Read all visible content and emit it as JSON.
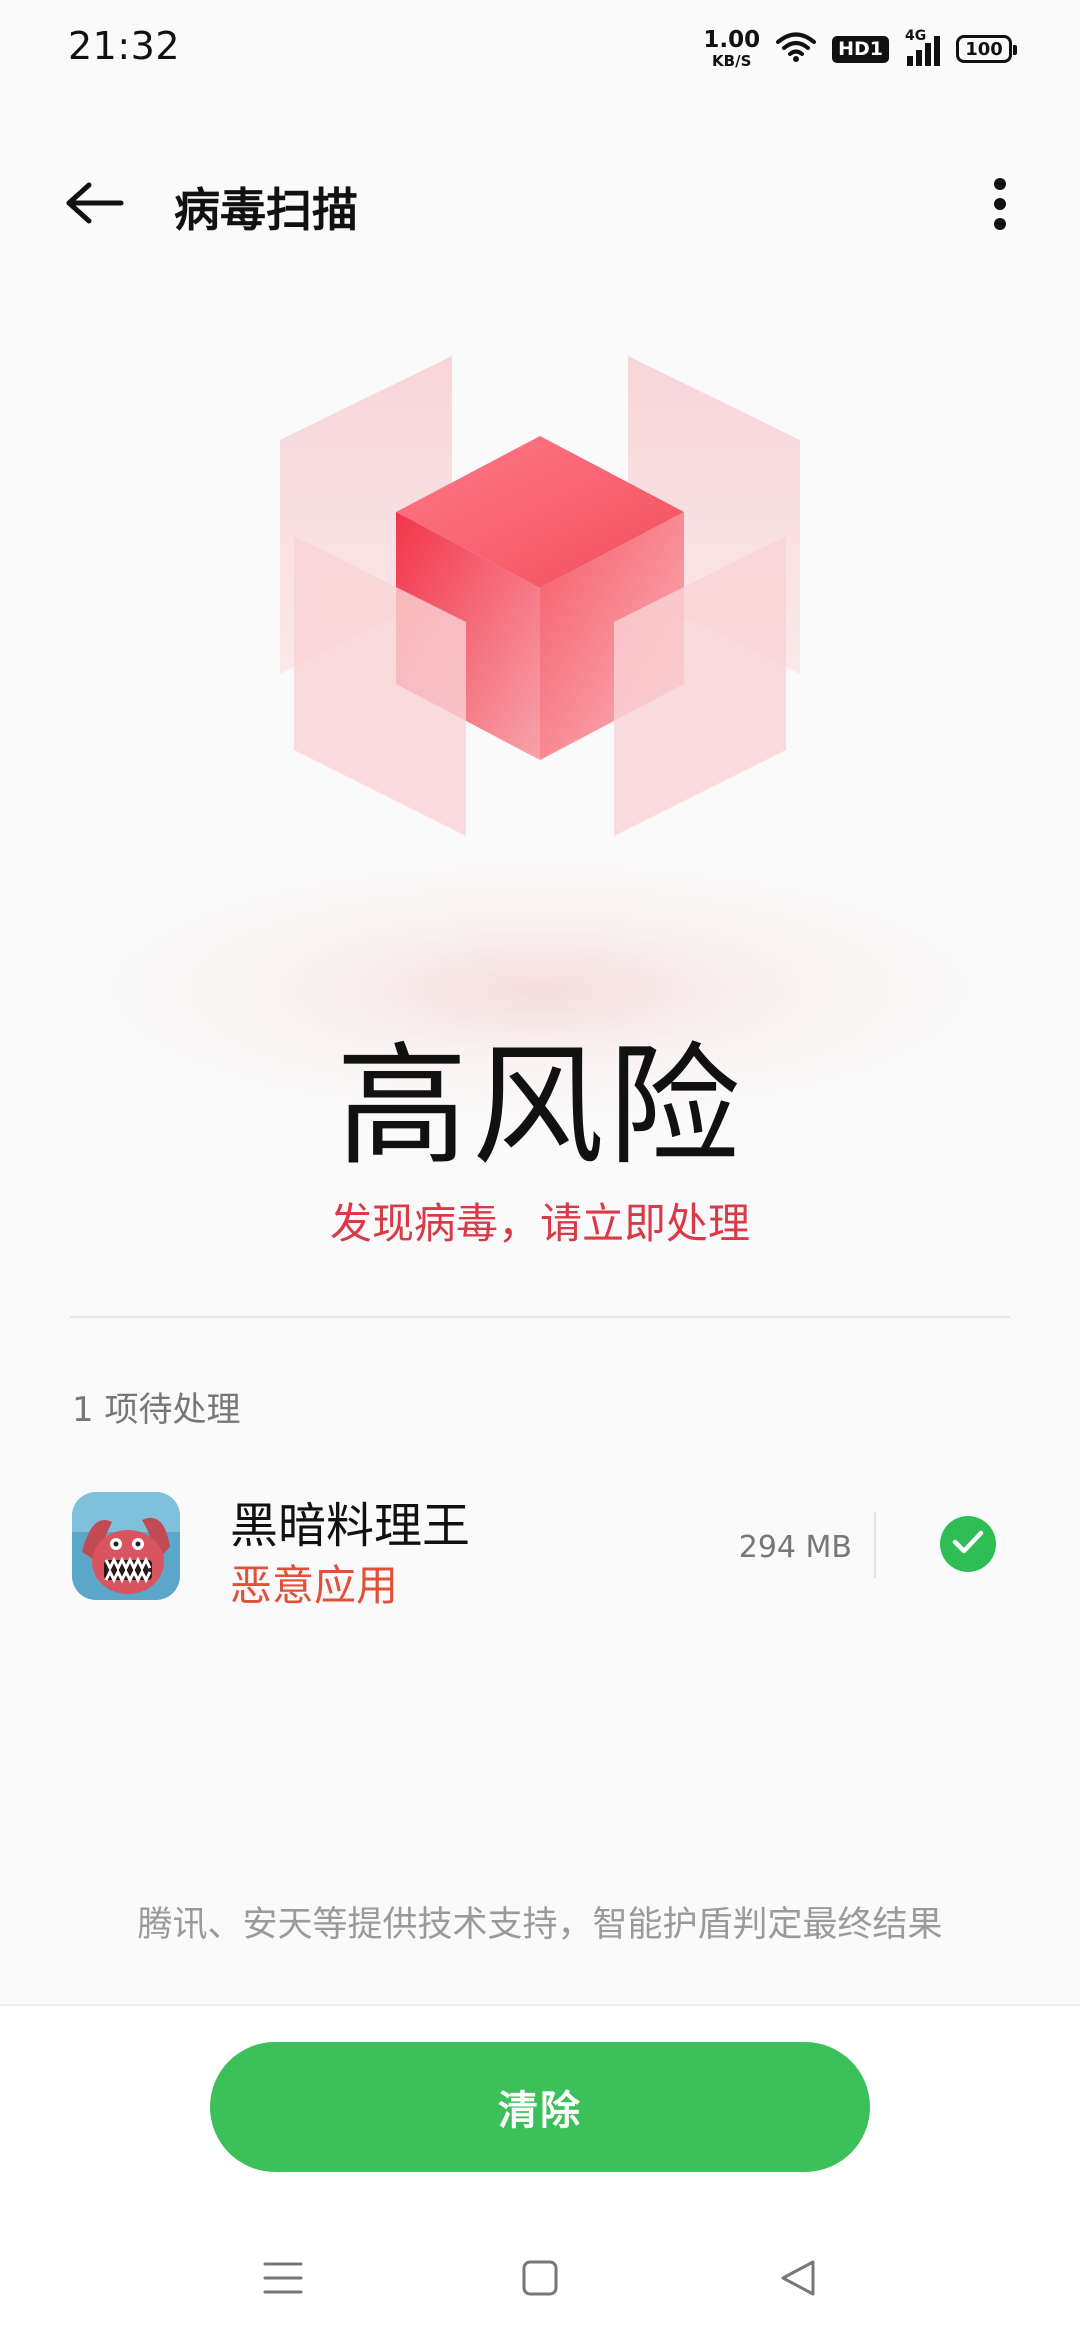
{
  "status_bar": {
    "time": "21:32",
    "net_speed_value": "1.00",
    "net_speed_unit": "KB/S",
    "hd_label": "HD1",
    "network_label": "4G",
    "battery": "100"
  },
  "app_bar": {
    "title": "病毒扫描"
  },
  "result": {
    "risk_level": "高风险",
    "message": "发现病毒，请立即处理"
  },
  "pending": {
    "label": "1 项待处理",
    "items": [
      {
        "name": "黑暗料理王",
        "status": "恶意应用",
        "size": "294 MB",
        "selected": true
      }
    ]
  },
  "footer_note": "腾讯、安天等提供技术支持，智能护盾判定最终结果",
  "actions": {
    "clear_label": "清除"
  },
  "icons": {
    "back": "arrow-left-icon",
    "more": "more-vertical-icon",
    "wifi": "wifi-icon",
    "signal": "signal-icon",
    "battery": "battery-icon",
    "check": "check-icon",
    "nav_menu": "menu-icon",
    "nav_home": "home-square-icon",
    "nav_back": "back-triangle-icon"
  },
  "colors": {
    "accent_green": "#3cc05a",
    "risk_red": "#d93a48",
    "malware_orange": "#e0513a"
  }
}
